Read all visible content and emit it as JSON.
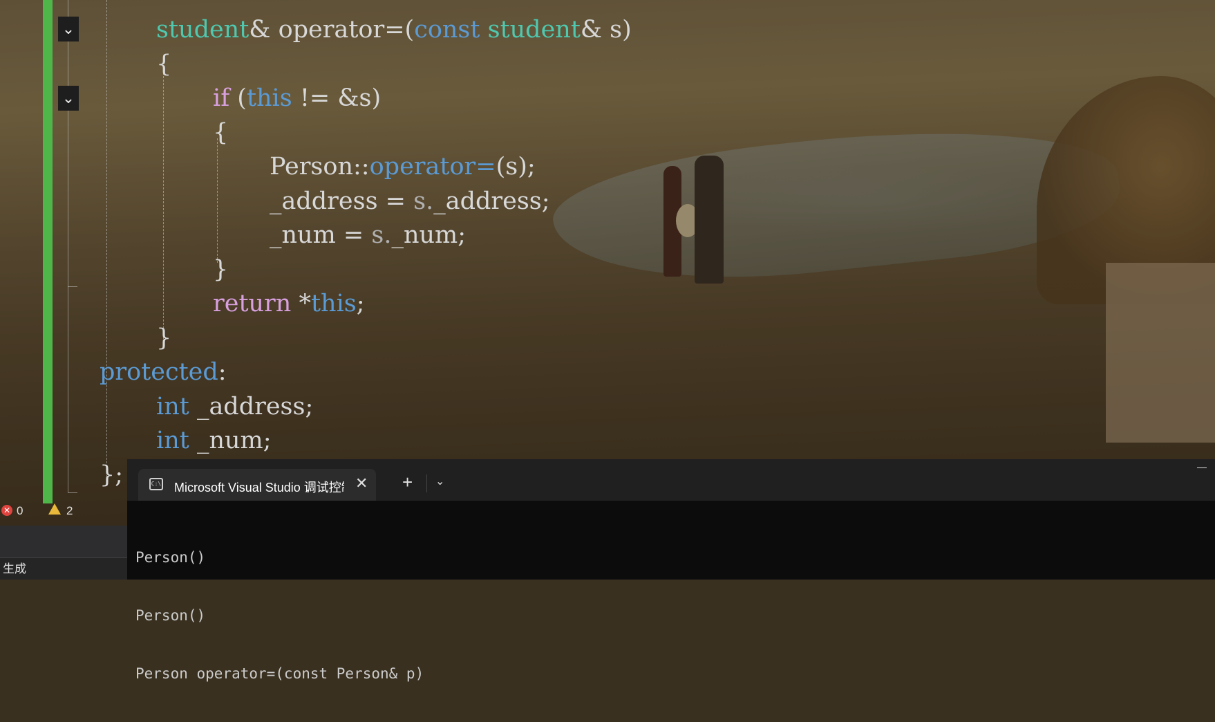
{
  "editor": {
    "lines": [
      {
        "indent": 0,
        "tokens": [
          {
            "t": "student",
            "c": "ty"
          },
          {
            "t": "& operator=("
          },
          {
            "t": "const",
            "c": "kw"
          },
          {
            "t": " "
          },
          {
            "t": "student",
            "c": "ty"
          },
          {
            "t": "& s)"
          }
        ]
      },
      {
        "indent": 0,
        "tokens": [
          {
            "t": "{"
          }
        ]
      },
      {
        "indent": 1,
        "tokens": [
          {
            "t": "if",
            "c": "ctl"
          },
          {
            "t": " ("
          },
          {
            "t": "this",
            "c": "kw"
          },
          {
            "t": " != &s)"
          }
        ]
      },
      {
        "indent": 1,
        "tokens": [
          {
            "t": "{"
          }
        ]
      },
      {
        "indent": 2,
        "tokens": [
          {
            "t": "Person::"
          },
          {
            "t": "operator=",
            "c": "kw"
          },
          {
            "t": "(s);"
          }
        ]
      },
      {
        "indent": 2,
        "tokens": [
          {
            "t": "_address = "
          },
          {
            "t": "s.",
            "c": "dim"
          },
          {
            "t": "_address;"
          }
        ]
      },
      {
        "indent": 2,
        "tokens": [
          {
            "t": "_num = "
          },
          {
            "t": "s.",
            "c": "dim"
          },
          {
            "t": "_num;"
          }
        ]
      },
      {
        "indent": 1,
        "tokens": [
          {
            "t": "}"
          }
        ]
      },
      {
        "indent": 1,
        "tokens": [
          {
            "t": "return",
            "c": "ctl"
          },
          {
            "t": " *"
          },
          {
            "t": "this",
            "c": "kw"
          },
          {
            "t": ";"
          }
        ]
      },
      {
        "indent": 0,
        "tokens": [
          {
            "t": "}"
          }
        ]
      },
      {
        "indent": -1,
        "tokens": [
          {
            "t": "protected",
            "c": "kw"
          },
          {
            "t": ":"
          }
        ]
      },
      {
        "indent": 0,
        "tokens": [
          {
            "t": "int",
            "c": "kw"
          },
          {
            "t": " _address;"
          }
        ]
      },
      {
        "indent": 0,
        "tokens": [
          {
            "t": "int",
            "c": "kw"
          },
          {
            "t": " _num;"
          }
        ]
      },
      {
        "indent": -1,
        "tokens": [
          {
            "t": "};"
          }
        ]
      }
    ]
  },
  "status": {
    "errors": "0",
    "warnings": "2",
    "build_tab": "生成"
  },
  "terminal": {
    "tab_title": "Microsoft Visual Studio 调试控制台",
    "new_tab_label": "+",
    "output": [
      "Person()",
      "Person()",
      "Person operator=(const Person& p)"
    ]
  },
  "icons": {
    "fold": "chevron-down-icon",
    "error": "error-icon",
    "warning": "warning-icon",
    "terminal": "terminal-icon",
    "close": "close-icon",
    "minimize": "minimize-icon"
  },
  "colors": {
    "change_bar": "#4fb64a",
    "keyword": "#5b9bd5",
    "type": "#4ec9b0",
    "control": "#d8a0df"
  }
}
